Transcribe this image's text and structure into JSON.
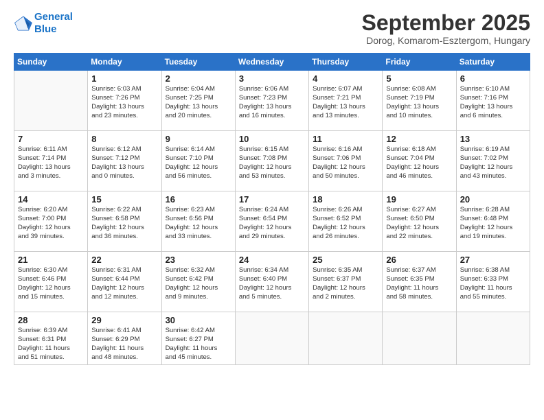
{
  "header": {
    "logo_line1": "General",
    "logo_line2": "Blue",
    "month_title": "September 2025",
    "subtitle": "Dorog, Komarom-Esztergom, Hungary"
  },
  "weekdays": [
    "Sunday",
    "Monday",
    "Tuesday",
    "Wednesday",
    "Thursday",
    "Friday",
    "Saturday"
  ],
  "weeks": [
    [
      {
        "day": "",
        "info": ""
      },
      {
        "day": "1",
        "info": "Sunrise: 6:03 AM\nSunset: 7:26 PM\nDaylight: 13 hours\nand 23 minutes."
      },
      {
        "day": "2",
        "info": "Sunrise: 6:04 AM\nSunset: 7:25 PM\nDaylight: 13 hours\nand 20 minutes."
      },
      {
        "day": "3",
        "info": "Sunrise: 6:06 AM\nSunset: 7:23 PM\nDaylight: 13 hours\nand 16 minutes."
      },
      {
        "day": "4",
        "info": "Sunrise: 6:07 AM\nSunset: 7:21 PM\nDaylight: 13 hours\nand 13 minutes."
      },
      {
        "day": "5",
        "info": "Sunrise: 6:08 AM\nSunset: 7:19 PM\nDaylight: 13 hours\nand 10 minutes."
      },
      {
        "day": "6",
        "info": "Sunrise: 6:10 AM\nSunset: 7:16 PM\nDaylight: 13 hours\nand 6 minutes."
      }
    ],
    [
      {
        "day": "7",
        "info": "Sunrise: 6:11 AM\nSunset: 7:14 PM\nDaylight: 13 hours\nand 3 minutes."
      },
      {
        "day": "8",
        "info": "Sunrise: 6:12 AM\nSunset: 7:12 PM\nDaylight: 13 hours\nand 0 minutes."
      },
      {
        "day": "9",
        "info": "Sunrise: 6:14 AM\nSunset: 7:10 PM\nDaylight: 12 hours\nand 56 minutes."
      },
      {
        "day": "10",
        "info": "Sunrise: 6:15 AM\nSunset: 7:08 PM\nDaylight: 12 hours\nand 53 minutes."
      },
      {
        "day": "11",
        "info": "Sunrise: 6:16 AM\nSunset: 7:06 PM\nDaylight: 12 hours\nand 50 minutes."
      },
      {
        "day": "12",
        "info": "Sunrise: 6:18 AM\nSunset: 7:04 PM\nDaylight: 12 hours\nand 46 minutes."
      },
      {
        "day": "13",
        "info": "Sunrise: 6:19 AM\nSunset: 7:02 PM\nDaylight: 12 hours\nand 43 minutes."
      }
    ],
    [
      {
        "day": "14",
        "info": "Sunrise: 6:20 AM\nSunset: 7:00 PM\nDaylight: 12 hours\nand 39 minutes."
      },
      {
        "day": "15",
        "info": "Sunrise: 6:22 AM\nSunset: 6:58 PM\nDaylight: 12 hours\nand 36 minutes."
      },
      {
        "day": "16",
        "info": "Sunrise: 6:23 AM\nSunset: 6:56 PM\nDaylight: 12 hours\nand 33 minutes."
      },
      {
        "day": "17",
        "info": "Sunrise: 6:24 AM\nSunset: 6:54 PM\nDaylight: 12 hours\nand 29 minutes."
      },
      {
        "day": "18",
        "info": "Sunrise: 6:26 AM\nSunset: 6:52 PM\nDaylight: 12 hours\nand 26 minutes."
      },
      {
        "day": "19",
        "info": "Sunrise: 6:27 AM\nSunset: 6:50 PM\nDaylight: 12 hours\nand 22 minutes."
      },
      {
        "day": "20",
        "info": "Sunrise: 6:28 AM\nSunset: 6:48 PM\nDaylight: 12 hours\nand 19 minutes."
      }
    ],
    [
      {
        "day": "21",
        "info": "Sunrise: 6:30 AM\nSunset: 6:46 PM\nDaylight: 12 hours\nand 15 minutes."
      },
      {
        "day": "22",
        "info": "Sunrise: 6:31 AM\nSunset: 6:44 PM\nDaylight: 12 hours\nand 12 minutes."
      },
      {
        "day": "23",
        "info": "Sunrise: 6:32 AM\nSunset: 6:42 PM\nDaylight: 12 hours\nand 9 minutes."
      },
      {
        "day": "24",
        "info": "Sunrise: 6:34 AM\nSunset: 6:40 PM\nDaylight: 12 hours\nand 5 minutes."
      },
      {
        "day": "25",
        "info": "Sunrise: 6:35 AM\nSunset: 6:37 PM\nDaylight: 12 hours\nand 2 minutes."
      },
      {
        "day": "26",
        "info": "Sunrise: 6:37 AM\nSunset: 6:35 PM\nDaylight: 11 hours\nand 58 minutes."
      },
      {
        "day": "27",
        "info": "Sunrise: 6:38 AM\nSunset: 6:33 PM\nDaylight: 11 hours\nand 55 minutes."
      }
    ],
    [
      {
        "day": "28",
        "info": "Sunrise: 6:39 AM\nSunset: 6:31 PM\nDaylight: 11 hours\nand 51 minutes."
      },
      {
        "day": "29",
        "info": "Sunrise: 6:41 AM\nSunset: 6:29 PM\nDaylight: 11 hours\nand 48 minutes."
      },
      {
        "day": "30",
        "info": "Sunrise: 6:42 AM\nSunset: 6:27 PM\nDaylight: 11 hours\nand 45 minutes."
      },
      {
        "day": "",
        "info": ""
      },
      {
        "day": "",
        "info": ""
      },
      {
        "day": "",
        "info": ""
      },
      {
        "day": "",
        "info": ""
      }
    ]
  ]
}
